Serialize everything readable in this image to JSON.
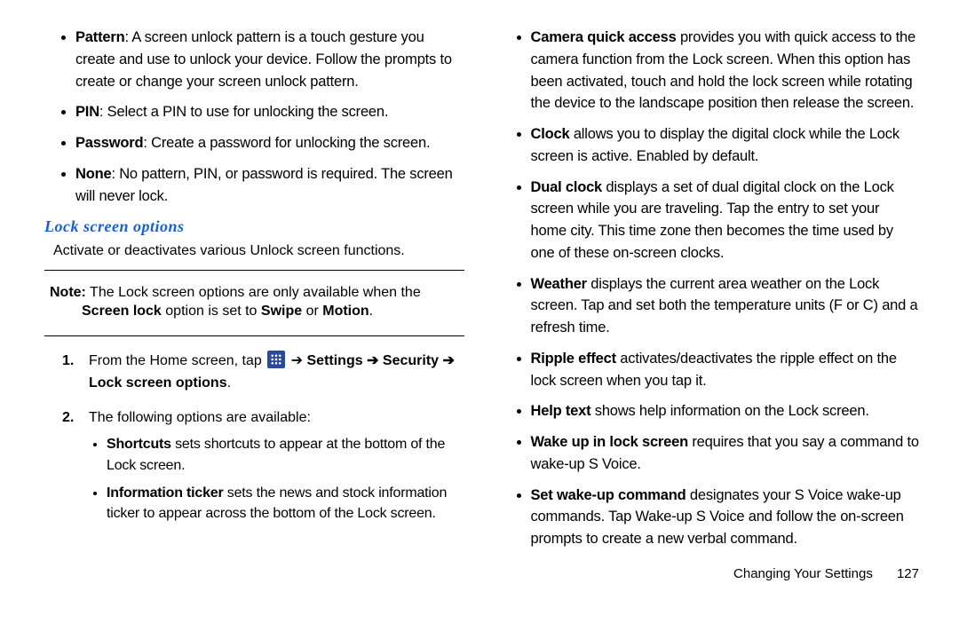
{
  "left": {
    "lock_types": [
      {
        "term": "Pattern",
        "desc": ": A screen unlock pattern is a touch gesture you create and use to unlock your device. Follow the prompts to create or change your screen unlock pattern."
      },
      {
        "term": "PIN",
        "desc": ": Select a PIN to use for unlocking the screen."
      },
      {
        "term": "Password",
        "desc": ": Create a password for unlocking the screen."
      },
      {
        "term": "None",
        "desc": ": No pattern, PIN, or password is required. The screen will never lock."
      }
    ],
    "heading": "Lock screen options",
    "intro": "Activate or deactivates various Unlock screen functions.",
    "note_lead": "Note:",
    "note_text": " The Lock screen options are only available when the ",
    "note_b1": "Screen lock",
    "note_mid": " option is set to ",
    "note_b2": "Swipe",
    "note_or": " or ",
    "note_b3": "Motion",
    "step1_a": "From the Home screen, tap ",
    "step1_b": " ➔ ",
    "step1_settings": "Settings ➔ Security ➔ Lock screen options",
    "step1_end": ".",
    "step2": "The following options are available:",
    "step2_items": [
      {
        "term": "Shortcuts",
        "desc": " sets shortcuts to appear at the bottom of the Lock screen."
      },
      {
        "term": "Information ticker",
        "desc": " sets the news and stock information ticker to appear across the bottom of the Lock screen."
      }
    ]
  },
  "right": {
    "items": [
      {
        "term": "Camera quick access",
        "desc": " provides you with quick access to the camera function from the Lock screen. When this option has been activated, touch and hold the lock screen while rotating the device to the landscape position then release the screen."
      },
      {
        "term": "Clock",
        "desc": " allows you to display the digital clock while the Lock screen is active. Enabled by default."
      },
      {
        "term": "Dual clock",
        "desc": " displays a set of dual digital clock on the Lock screen while you are traveling. Tap the entry to set your home city. This time zone then becomes the time used by one of these on-screen clocks."
      },
      {
        "term": "Weather",
        "desc": " displays the current area weather on the Lock screen. Tap and set both the temperature units (F or C) and a refresh time."
      },
      {
        "term": "Ripple effect",
        "desc": " activates/deactivates the ripple effect on the lock screen when you tap it."
      },
      {
        "term": "Help text",
        "desc": " shows help information on the Lock screen."
      },
      {
        "term": "Wake up in lock screen",
        "desc": " requires that you say a command to wake-up S Voice."
      },
      {
        "term": "Set wake-up command",
        "desc": " designates your S Voice wake-up commands. Tap Wake-up S Voice and follow the on-screen prompts to create a new verbal command."
      }
    ]
  },
  "footer": {
    "chapter": "Changing Your Settings",
    "page": "127"
  }
}
